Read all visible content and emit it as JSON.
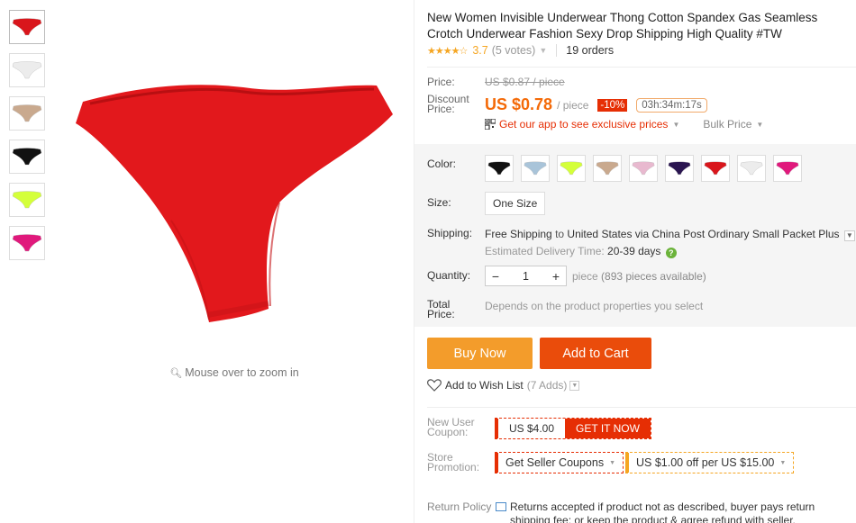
{
  "thumbnails": [
    {
      "color": "#d9161c",
      "name": "red-thumb"
    },
    {
      "color": "#ececec",
      "name": "white-thumb"
    },
    {
      "color": "#c9a98e",
      "name": "nude-thumb"
    },
    {
      "color": "#111111",
      "name": "black-thumb"
    },
    {
      "color": "#d4ff3a",
      "name": "lime-thumb"
    },
    {
      "color": "#e0197c",
      "name": "pink-thumb"
    }
  ],
  "zoom_hint": "Mouse over to zoom in",
  "product": {
    "title": "New Women Invisible Underwear Thong Cotton Spandex Gas Seamless Crotch Underwear Fashion Sexy Drop Shipping High Quality #TW",
    "stars": "★★★★☆",
    "rating": "3.7",
    "votes": "(5 votes)",
    "orders": "19 orders"
  },
  "price": {
    "label": "Price:",
    "original": "US $0.87 / piece",
    "discount_label_1": "Discount",
    "discount_label_2": "Price:",
    "current": "US $0.78",
    "unit": "/ piece",
    "discount": "-10%",
    "timer": "03h:34m:17s",
    "app_link": "Get our app to see exclusive prices",
    "bulk": "Bulk Price"
  },
  "color": {
    "label": "Color:",
    "swatches": [
      "#111111",
      "#a9c4d9",
      "#d4ff3a",
      "#c9a98e",
      "#e8b9cf",
      "#2a1550",
      "#d9161c",
      "#ececec",
      "#e0197c"
    ]
  },
  "size": {
    "label": "Size:",
    "value": "One Size"
  },
  "shipping": {
    "label": "Shipping:",
    "free": "Free Shipping",
    "to": "to",
    "dest": "United States via China Post Ordinary Small Packet Plus",
    "delivery_label": "Estimated Delivery Time:",
    "delivery_days": "20-39 days"
  },
  "quantity": {
    "label": "Quantity:",
    "value": "1",
    "minus": "−",
    "plus": "+",
    "unit": "piece",
    "available": "(893 pieces available)"
  },
  "total": {
    "label_1": "Total",
    "label_2": "Price:",
    "note": "Depends on the product properties you select"
  },
  "buttons": {
    "buy_now": "Buy Now",
    "add_to_cart": "Add to Cart"
  },
  "wishlist": {
    "label": "Add to Wish List",
    "count": "(7 Adds)"
  },
  "coupon": {
    "label_1": "New User",
    "label_2": "Coupon:",
    "value": "US $4.00",
    "action": "GET IT NOW"
  },
  "store": {
    "label_1": "Store",
    "label_2": "Promotion:",
    "seller_coupons": "Get Seller Coupons",
    "promo": "US $1.00 off per US $15.00"
  },
  "return_policy": {
    "label": "Return Policy",
    "text": "Returns accepted if product not as described, buyer pays return shipping fee; or keep the product & agree refund with seller."
  },
  "colors": {
    "accent_orange": "#f46a08",
    "red": "#e62e04",
    "star": "#f5a623",
    "buy": "#f39c2b",
    "cart": "#ea4c0b"
  }
}
